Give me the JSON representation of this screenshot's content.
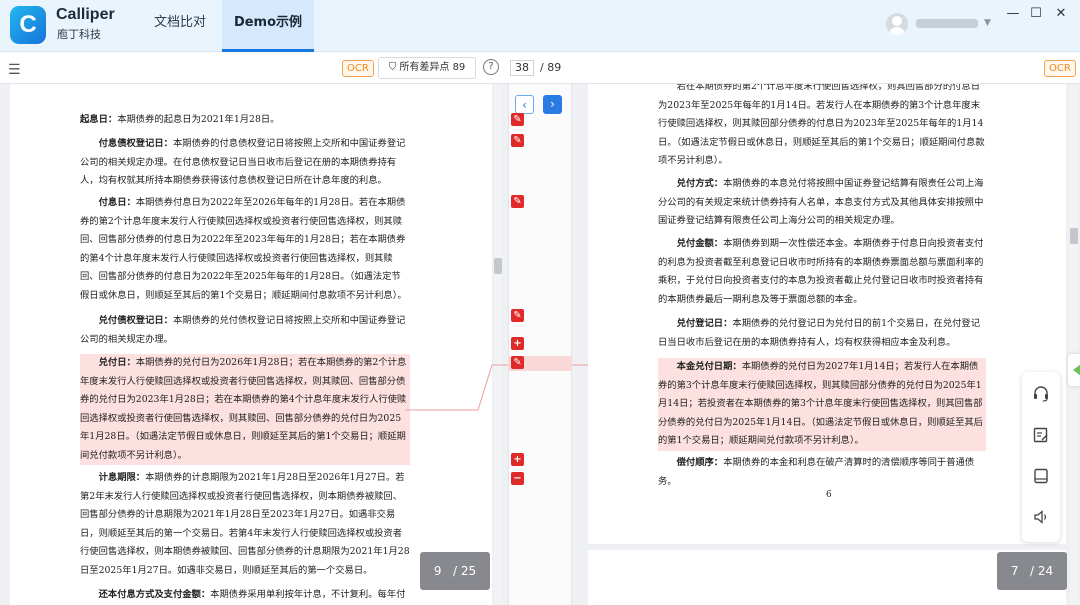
{
  "app": {
    "name": "Calliper",
    "subtitle": "庖丁科技",
    "logo_letter": "C"
  },
  "tabs": [
    {
      "label": "文档比对"
    },
    {
      "label": "Demo示例",
      "active": true
    }
  ],
  "window_controls": {
    "minimize": "—",
    "maximize": "☐",
    "close": "✕"
  },
  "toolbar": {
    "ocr_label": "OCR",
    "filter_label": "所有差异点 89",
    "help": "?",
    "current_diff": "38",
    "total_diff": "/ 89"
  },
  "left_doc": {
    "paragraphs": [
      {
        "title": "起息日：",
        "text": "本期债券的起息日为2021年1月28日。"
      },
      {
        "title": "付息债权登记日：",
        "text": "本期债券的付息债权登记日将按照上交所和中国证券登记公司的相关规定办理。在付息债权登记日当日收市后登记在册的本期债券持有人，均有权就其所持本期债券获得该付息债权登记日所在计息年度的利息。"
      },
      {
        "title": "付息日：",
        "text": "本期债券付息日为2022年至2026年每年的1月28日。若在本期债券的第2个计息年度末发行人行使赎回选择权或投资者行使回售选择权，则其赎回、回售部分债券的付息日为2022年至2023年每年的1月28日；若在本期债券的第4个计息年度末发行人行使赎回选择权或投资者行使回售选择权，则其赎回、回售部分债券的付息日为2022年至2025年每年的1月28日。（如遇法定节假日或休息日，则顺延至其后的第1个交易日；顺延期间付息款项不另计利息）。"
      },
      {
        "title": "兑付债权登记日：",
        "text": "本期债券的兑付债权登记日将按照上交所和中国证券登记公司的相关规定办理。"
      },
      {
        "title": "兑付日：",
        "text": "本期债券的兑付日为2026年1月28日；若在本期债券的第2个计息年度末发行人行使赎回选择权或投资者行使回售选择权，则其赎回、回售部分债券的兑付日为2023年1月28日；若在本期债券的第4个计息年度末发行人行使赎回选择权或投资者行使回售选择权，则其赎回、回售部分债券的兑付日为2025年1月28日。（如遇法定节假日或休息日，则顺延至其后的第1个交易日；顺延期间兑付款项不另计利息）。"
      },
      {
        "title": "计息期限：",
        "text": "本期债券的计息期限为2021年1月28日至2026年1月27日。若第2年末发行人行使赎回选择权或投资者行使回售选择权，则本期债券被赎回、回售部分债券的计息期限为2021年1月28日至2023年1月27日。如遇非交易日，则顺延至其后的第一个交易日。若第4年末发行人行使赎回选择权或投资者行使回售选择权，则本期债券被赎回、回售部分债券的计息期限为2021年1月28日至2025年1月27日。如遇非交易日，则顺延至其后的第一个交易日。"
      },
      {
        "title": "还本付息方式及支付金额：",
        "text": "本期债券采用单利按年计息，不计复利。每年付"
      }
    ],
    "page_indicator": {
      "current": "9",
      "total": "/ 25"
    }
  },
  "right_doc": {
    "paragraphs": [
      {
        "title": "",
        "text": "若在本期债券的第2个计息年度末行使回售选择权，则其回售部分的付息日为2023年至2025年每年的1月14日。若发行人在本期债券的第3个计息年度末行使赎回选择权，则其赎回部分债券的付息日为2023年至2025年每年的1月14日。（如遇法定节假日或休息日，则顺延至其后的第1个交易日；顺延期间付息款项不另计利息）。"
      },
      {
        "title": "兑付方式：",
        "text": "本期债券的本息兑付将按照中国证券登记结算有限责任公司上海分公司的有关规定来统计债券持有人名单，本息支付方式及其他具体安排按照中国证券登记结算有限责任公司上海分公司的相关规定办理。"
      },
      {
        "title": "兑付金额：",
        "text": "本期债券到期一次性偿还本金。本期债券于付息日向投资者支付的利息为投资者截至利息登记日收市时所持有的本期债券票面总额与票面利率的乘积，于兑付日向投资者支付的本息为投资者截止兑付登记日收市时投资者持有的本期债券最后一期利息及等于票面总额的本金。"
      },
      {
        "title": "兑付登记日：",
        "text": "本期债券的兑付登记日为兑付日的前1个交易日，在兑付登记日当日收市后登记在册的本期债券持有人，均有权获得相应本金及利息。"
      },
      {
        "title": "本金兑付日期：",
        "text": "本期债券的兑付日为2027年1月14日；若发行人在本期债券的第3个计息年度末行使赎回选择权，则其赎回部分债券的兑付日为2025年1月14日；若投资者在本期债券的第3个计息年度末行使回售选择权，则其回售部分债券的兑付日为2025年1月14日。（如遇法定节假日或休息日，则顺延至其后的第1个交易日；顺延期间兑付款项不另计利息）。"
      },
      {
        "title": "偿付顺序：",
        "text": "本期债券的本金和利息在破产清算时的清偿顺序等同于普通债务。"
      }
    ],
    "page_number": "6",
    "page_indicator": {
      "current": "7",
      "total": "/ 24"
    }
  },
  "colors": {
    "accent": "#1677e0",
    "diff_red": "#e02a2a",
    "highlight": "#fde0e0",
    "ocr_orange": "#ef8a14"
  }
}
